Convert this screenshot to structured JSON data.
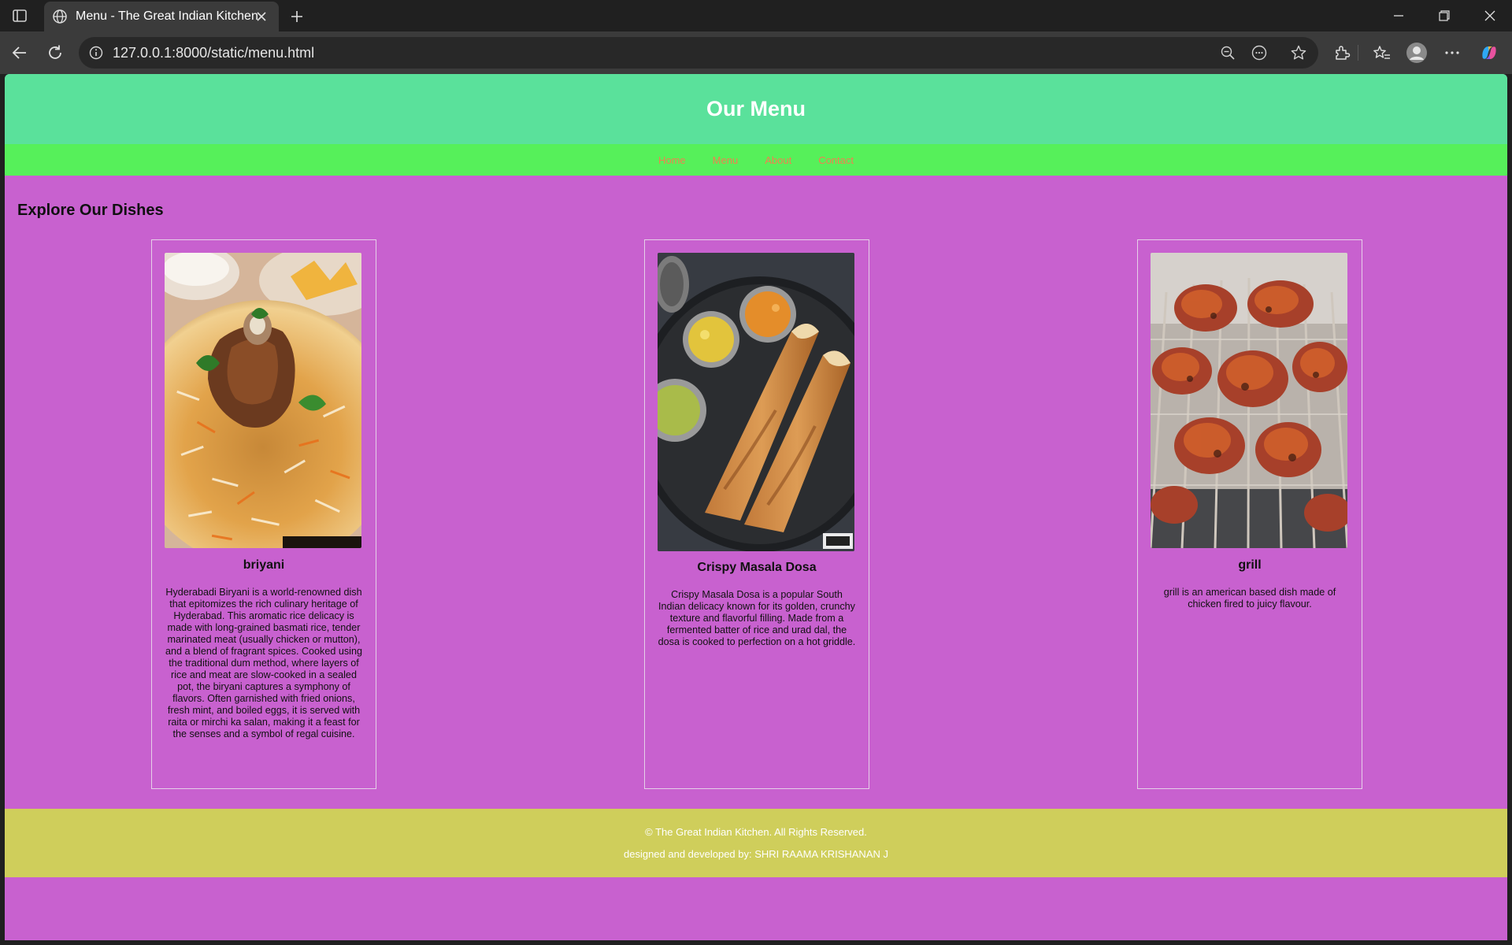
{
  "browser": {
    "tab_title": "Menu - The Great Indian Kitchen",
    "url": "127.0.0.1:8000/static/menu.html"
  },
  "site": {
    "header_title": "Our Menu",
    "nav": [
      "Home",
      "Menu",
      "About",
      "Contact"
    ],
    "section_title": "Explore Our Dishes",
    "dishes": [
      {
        "name": "briyani",
        "description": "Hyderabadi Biryani is a world-renowned dish that epitomizes the rich culinary heritage of Hyderabad. This aromatic rice delicacy is made with long-grained basmati rice, tender marinated meat (usually chicken or mutton), and a blend of fragrant spices. Cooked using the traditional dum method, where layers of rice and meat are slow-cooked in a sealed pot, the biryani captures a symphony of flavors. Often garnished with fried onions, fresh mint, and boiled eggs, it is served with raita or mirchi ka salan, making it a feast for the senses and a symbol of regal cuisine."
      },
      {
        "name": "Crispy Masala Dosa",
        "description": "Crispy Masala Dosa is a popular South Indian delicacy known for its golden, crunchy texture and flavorful filling. Made from a fermented batter of rice and urad dal, the dosa is cooked to perfection on a hot griddle."
      },
      {
        "name": "grill",
        "description": "grill is an american based dish made of chicken fired to juicy flavour."
      }
    ],
    "footer_copyright": "© The Great Indian Kitchen. All Rights Reserved.",
    "footer_credit": "designed and developed by: SHRI RAAMA KRISHANAN J"
  },
  "colors": {
    "header": "#5ae19b",
    "nav": "#56f05a",
    "page": "#c861cf",
    "footer": "#cfce5b",
    "nav_link": "#f08050"
  },
  "icons": [
    "sidebar-toggle-icon",
    "globe-icon",
    "close-icon",
    "plus-icon",
    "minimize-icon",
    "restore-icon",
    "back-arrow-icon",
    "reload-icon",
    "info-icon",
    "zoom-out-icon",
    "reading-mode-icon",
    "star-icon",
    "extensions-icon",
    "favorites-icon",
    "profile-icon",
    "more-icon",
    "copilot-icon"
  ]
}
